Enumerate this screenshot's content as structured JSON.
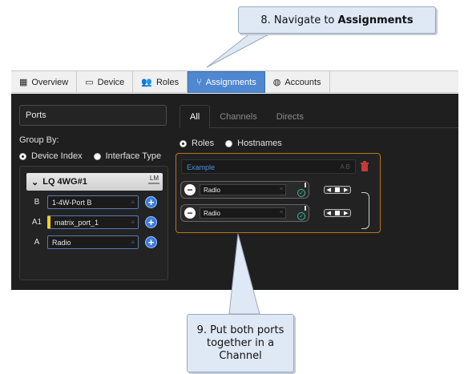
{
  "callouts": {
    "top_prefix": "8. Navigate to ",
    "top_bold": "Assignments",
    "bottom": "9. Put both ports together in a Channel"
  },
  "tabs": [
    {
      "label": "Overview",
      "icon": "grid-icon"
    },
    {
      "label": "Device",
      "icon": "device-icon"
    },
    {
      "label": "Roles",
      "icon": "users-icon"
    },
    {
      "label": "Assignments",
      "icon": "assignments-icon",
      "active": true
    },
    {
      "label": "Accounts",
      "icon": "globe-icon"
    }
  ],
  "left": {
    "ports_label": "Ports",
    "group_by": "Group By:",
    "options": [
      "Device Index",
      "Interface Type"
    ],
    "device_name": "LQ 4WG#1",
    "device_badge": "LM",
    "ports": [
      {
        "key": "B",
        "name": "1-4W-Port B"
      },
      {
        "key": "A1",
        "name": "matrix_port_1"
      },
      {
        "key": "A",
        "name": "Radio"
      }
    ]
  },
  "right": {
    "tabs": [
      "All",
      "Channels",
      "Directs"
    ],
    "view_options": [
      "Roles",
      "Hostnames"
    ],
    "channel_name": "Example",
    "channel_hint": "A B",
    "members": [
      "Radio",
      "Radio"
    ]
  },
  "colors": {
    "accent": "#4f88d0",
    "channel_border": "#b7741e",
    "callout_bg": "#dfe8f5"
  }
}
